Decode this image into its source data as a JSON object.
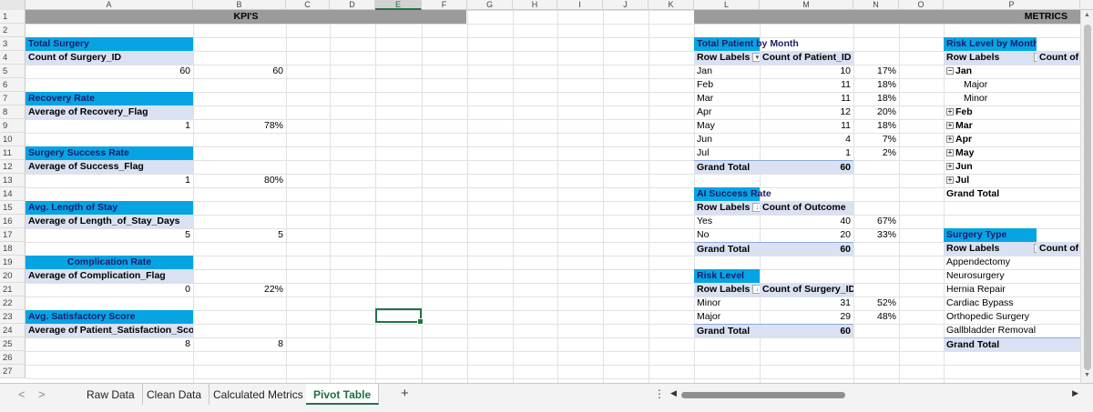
{
  "columns": [
    "A",
    "B",
    "C",
    "D",
    "E",
    "F",
    "G",
    "H",
    "I",
    "J",
    "K",
    "L",
    "M",
    "N",
    "O",
    "P"
  ],
  "active_column": "E",
  "rows": [
    "1",
    "2",
    "3",
    "4",
    "5",
    "6",
    "7",
    "8",
    "9",
    "10",
    "11",
    "12",
    "13",
    "14",
    "15",
    "16",
    "17",
    "18",
    "19",
    "20",
    "21",
    "22",
    "23",
    "24",
    "25",
    "26",
    "27"
  ],
  "banners": {
    "kpis": "KPI'S",
    "metrics": "METRICS"
  },
  "kpis": [
    {
      "title": "Total Surgery",
      "sub": "Count of Surgery_ID",
      "value": "60",
      "calc": "60"
    },
    {
      "title": "Recovery Rate",
      "sub": "Average of Recovery_Flag",
      "value": "1",
      "calc": "78%"
    },
    {
      "title": "Surgery Success Rate",
      "sub": "Average of Success_Flag",
      "value": "1",
      "calc": "80%"
    },
    {
      "title": "Avg. Length of Stay",
      "sub": "Average of Length_of_Stay_Days",
      "value": "5",
      "calc": "5"
    },
    {
      "title": "Complication Rate",
      "sub": "Average of Complication_Flag",
      "value": "0",
      "calc": "22%"
    },
    {
      "title": "Avg. Satisfactory Score",
      "sub": "Average of Patient_Satisfaction_Score",
      "value": "8",
      "calc": "8"
    }
  ],
  "pivot_month": {
    "title": "Total Patient by Month",
    "row_labels": "Row Labels",
    "value_header": "Count of Patient_ID",
    "rows": [
      {
        "label": "Jan",
        "value": "10",
        "pct": "17%"
      },
      {
        "label": "Feb",
        "value": "11",
        "pct": "18%"
      },
      {
        "label": "Mar",
        "value": "11",
        "pct": "18%"
      },
      {
        "label": "Apr",
        "value": "12",
        "pct": "20%"
      },
      {
        "label": "May",
        "value": "11",
        "pct": "18%"
      },
      {
        "label": "Jun",
        "value": "4",
        "pct": "7%"
      },
      {
        "label": "Jul",
        "value": "1",
        "pct": "2%"
      }
    ],
    "grand_label": "Grand Total",
    "grand_value": "60"
  },
  "pivot_ai": {
    "title": "AI Success Rate",
    "row_labels": "Row Labels",
    "value_header": "Count of Outcome",
    "rows": [
      {
        "label": "Yes",
        "value": "40",
        "pct": "67%"
      },
      {
        "label": "No",
        "value": "20",
        "pct": "33%"
      }
    ],
    "grand_label": "Grand Total",
    "grand_value": "60"
  },
  "pivot_risk": {
    "title": "Risk Level",
    "row_labels": "Row Labels",
    "value_header": "Count of Surgery_ID",
    "rows": [
      {
        "label": "Minor",
        "value": "31",
        "pct": "52%"
      },
      {
        "label": "Major",
        "value": "29",
        "pct": "48%"
      }
    ],
    "grand_label": "Grand Total",
    "grand_value": "60"
  },
  "pivot_risk_month": {
    "title": "Risk Level by Month",
    "row_labels": "Row Labels",
    "value_header": "Count of",
    "expanded": {
      "label": "Jan",
      "children": [
        "Major",
        "Minor"
      ]
    },
    "collapsed": [
      "Feb",
      "Mar",
      "Apr",
      "May",
      "Jun",
      "Jul"
    ],
    "grand_label": "Grand Total"
  },
  "pivot_surgery": {
    "title": "Surgery Type",
    "row_labels": "Row Labels",
    "value_header": "Count of",
    "rows": [
      "Appendectomy",
      "Neurosurgery",
      "Hernia Repair",
      "Cardiac Bypass",
      "Orthopedic Surgery",
      "Gallbladder Removal"
    ],
    "grand_label": "Grand Total"
  },
  "tabs": [
    "Raw Data",
    "Clean Data",
    "Calculated Metrics",
    "Pivot Table"
  ],
  "active_tab": "Pivot Table",
  "tab_add": "+",
  "nav": {
    "prev": "<",
    "next": ">",
    "dots": "⋮",
    "scroll_left": "◀",
    "scroll_right": "▶"
  }
}
